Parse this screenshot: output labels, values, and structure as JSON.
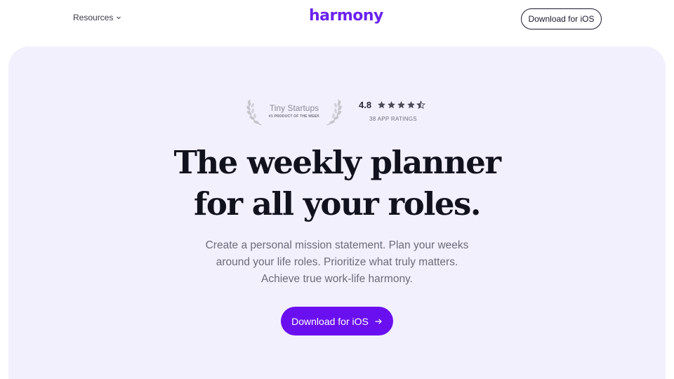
{
  "nav": {
    "resources_label": "Resources",
    "logo_text": "harmony",
    "download_label": "Download for iOS"
  },
  "award": {
    "name": "Tiny Startups",
    "subtitle": "#1 PRODUCT OF THE WEEK"
  },
  "rating": {
    "score": "4.8",
    "stars": 4.8,
    "count_label": "38 APP RATINGS"
  },
  "hero": {
    "headline_line1": "The weekly planner",
    "headline_line2": "for all your roles.",
    "sub_line1": "Create a personal mission statement. Plan your weeks",
    "sub_line2": "around your life roles. Prioritize what truly matters.",
    "sub_line3": "Achieve true work-life harmony.",
    "cta_label": "Download for iOS"
  },
  "colors": {
    "brand": "#6a22f0",
    "cta": "#6a10f0",
    "hero_bg": "#f3f0fe"
  }
}
